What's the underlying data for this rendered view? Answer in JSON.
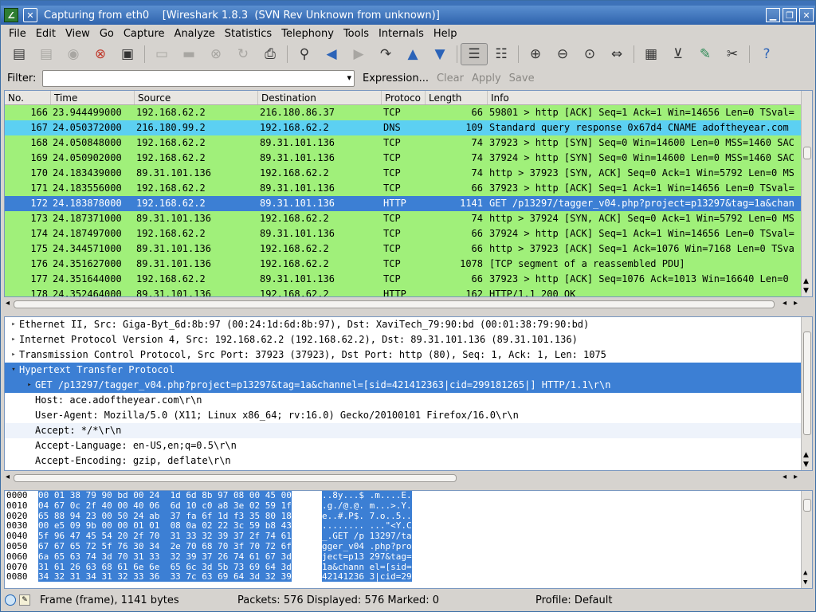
{
  "window": {
    "title": "Capturing from eth0    [Wireshark 1.8.3  (SVN Rev Unknown from unknown)]"
  },
  "menu": [
    "File",
    "Edit",
    "View",
    "Go",
    "Capture",
    "Analyze",
    "Statistics",
    "Telephony",
    "Tools",
    "Internals",
    "Help"
  ],
  "filter": {
    "label": "Filter:",
    "value": "",
    "expression": "Expression...",
    "clear": "Clear",
    "apply": "Apply",
    "save": "Save"
  },
  "packet_list": {
    "columns": [
      "No.",
      "Time",
      "Source",
      "Destination",
      "Protoco",
      "Length",
      "Info"
    ],
    "rows": [
      {
        "no": "166",
        "time": "23.944499000",
        "src": "192.168.62.2",
        "dst": "216.180.86.37",
        "proto": "TCP",
        "len": "66",
        "info": "59801 > http [ACK] Seq=1 Ack=1 Win=14656 Len=0 TSval=",
        "color": "#a0f07a"
      },
      {
        "no": "167",
        "time": "24.050372000",
        "src": "216.180.99.2",
        "dst": "192.168.62.2",
        "proto": "DNS",
        "len": "109",
        "info": "Standard query response 0x67d4  CNAME adoftheyear.com",
        "color": "#5cd0f2"
      },
      {
        "no": "168",
        "time": "24.050848000",
        "src": "192.168.62.2",
        "dst": "89.31.101.136",
        "proto": "TCP",
        "len": "74",
        "info": "37923 > http [SYN] Seq=0 Win=14600 Len=0 MSS=1460 SAC",
        "color": "#a0f07a"
      },
      {
        "no": "169",
        "time": "24.050902000",
        "src": "192.168.62.2",
        "dst": "89.31.101.136",
        "proto": "TCP",
        "len": "74",
        "info": "37924 > http [SYN] Seq=0 Win=14600 Len=0 MSS=1460 SAC",
        "color": "#a0f07a"
      },
      {
        "no": "170",
        "time": "24.183439000",
        "src": "89.31.101.136",
        "dst": "192.168.62.2",
        "proto": "TCP",
        "len": "74",
        "info": "http > 37923 [SYN, ACK] Seq=0 Ack=1 Win=5792 Len=0 MS",
        "color": "#a0f07a"
      },
      {
        "no": "171",
        "time": "24.183556000",
        "src": "192.168.62.2",
        "dst": "89.31.101.136",
        "proto": "TCP",
        "len": "66",
        "info": "37923 > http [ACK] Seq=1 Ack=1 Win=14656 Len=0 TSval=",
        "color": "#a0f07a"
      },
      {
        "no": "172",
        "time": "24.183878000",
        "src": "192.168.62.2",
        "dst": "89.31.101.136",
        "proto": "HTTP",
        "len": "1141",
        "info": "GET /p13297/tagger_v04.php?project=p13297&tag=1a&chan",
        "color": "#3c7fd4",
        "selected": true
      },
      {
        "no": "173",
        "time": "24.187371000",
        "src": "89.31.101.136",
        "dst": "192.168.62.2",
        "proto": "TCP",
        "len": "74",
        "info": "http > 37924 [SYN, ACK] Seq=0 Ack=1 Win=5792 Len=0 MS",
        "color": "#a0f07a"
      },
      {
        "no": "174",
        "time": "24.187497000",
        "src": "192.168.62.2",
        "dst": "89.31.101.136",
        "proto": "TCP",
        "len": "66",
        "info": "37924 > http [ACK] Seq=1 Ack=1 Win=14656 Len=0 TSval=",
        "color": "#a0f07a"
      },
      {
        "no": "175",
        "time": "24.344571000",
        "src": "89.31.101.136",
        "dst": "192.168.62.2",
        "proto": "TCP",
        "len": "66",
        "info": "http > 37923 [ACK] Seq=1 Ack=1076 Win=7168 Len=0 TSva",
        "color": "#a0f07a"
      },
      {
        "no": "176",
        "time": "24.351627000",
        "src": "89.31.101.136",
        "dst": "192.168.62.2",
        "proto": "TCP",
        "len": "1078",
        "info": "[TCP segment of a reassembled PDU]",
        "color": "#a0f07a"
      },
      {
        "no": "177",
        "time": "24.351644000",
        "src": "192.168.62.2",
        "dst": "89.31.101.136",
        "proto": "TCP",
        "len": "66",
        "info": "37923 > http [ACK] Seq=1076 Ack=1013 Win=16640 Len=0",
        "color": "#a0f07a"
      },
      {
        "no": "178",
        "time": "24.352464000",
        "src": "89.31.101.136",
        "dst": "192.168.62.2",
        "proto": "HTTP",
        "len": "162",
        "info": "HTTP/1.1 200 OK",
        "color": "#a0f07a"
      }
    ]
  },
  "details": [
    {
      "text": "Ethernet II, Src: Giga-Byt_6d:8b:97 (00:24:1d:6d:8b:97), Dst: XaviTech_79:90:bd (00:01:38:79:90:bd)",
      "indent": 0,
      "toggle": ">"
    },
    {
      "text": "Internet Protocol Version 4, Src: 192.168.62.2 (192.168.62.2), Dst: 89.31.101.136 (89.31.101.136)",
      "indent": 0,
      "toggle": ">"
    },
    {
      "text": "Transmission Control Protocol, Src Port: 37923 (37923), Dst Port: http (80), Seq: 1, Ack: 1, Len: 1075",
      "indent": 0,
      "toggle": ">"
    },
    {
      "text": "Hypertext Transfer Protocol",
      "indent": 0,
      "toggle": "v",
      "style": "section"
    },
    {
      "text": "GET /p13297/tagger_v04.php?project=p13297&tag=1a&channel=[sid=421412363|cid=299181265|] HTTP/1.1\\r\\n",
      "indent": 1,
      "toggle": ">",
      "style": "selected"
    },
    {
      "text": "Host: ace.adoftheyear.com\\r\\n",
      "indent": 1,
      "toggle": ""
    },
    {
      "text": "User-Agent: Mozilla/5.0 (X11; Linux x86_64; rv:16.0) Gecko/20100101 Firefox/16.0\\r\\n",
      "indent": 1,
      "toggle": ""
    },
    {
      "text": "Accept: */*\\r\\n",
      "indent": 1,
      "toggle": "",
      "style": "hover"
    },
    {
      "text": "Accept-Language: en-US,en;q=0.5\\r\\n",
      "indent": 1,
      "toggle": ""
    },
    {
      "text": "Accept-Encoding: gzip, deflate\\r\\n",
      "indent": 1,
      "toggle": ""
    }
  ],
  "bytes": [
    {
      "off": "0000",
      "hex1": "",
      "hexsel": "00 01 38 79 90 bd 00 24  1d 6d 8b 97 08 00 45 00",
      "ascsel": "..8y...$ .m....E."
    },
    {
      "off": "0010",
      "hex1": "",
      "hexsel": "04 67 0c 2f 40 00 40 06  6d 10 c0 a8 3e 02 59 1f",
      "ascsel": ".g./@.@. m...>.Y."
    },
    {
      "off": "0020",
      "hex1": "",
      "hexsel": "65 88 94 23 00 50 24 ab  37 fa 6f 1d f3 35 80 18",
      "ascsel": "e..#.P$. 7.o..5.."
    },
    {
      "off": "0030",
      "hex1": "",
      "hexsel": "00 e5 09 9b 00 00 01 01  08 0a 02 22 3c 59 b8 43",
      "ascsel": "........ ...\"<Y.C"
    },
    {
      "off": "0040",
      "hex1": "",
      "hexsel": "5f 96 47 45 54 20 2f 70  31 33 32 39 37 2f 74 61",
      "ascsel": "_.GET /p 13297/ta"
    },
    {
      "off": "0050",
      "hex1": "",
      "hexsel": "67 67 65 72 5f 76 30 34  2e 70 68 70 3f 70 72 6f",
      "ascsel": "gger_v04 .php?pro"
    },
    {
      "off": "0060",
      "hex1": "",
      "hexsel": "6a 65 63 74 3d 70 31 33  32 39 37 26 74 61 67 3d",
      "ascsel": "ject=p13 297&tag="
    },
    {
      "off": "0070",
      "hex1": "",
      "hexsel": "31 61 26 63 68 61 6e 6e  65 6c 3d 5b 73 69 64 3d",
      "ascsel": "1a&chann el=[sid="
    },
    {
      "off": "0080",
      "hex1": "",
      "hexsel": "34 32 31 34 31 32 33 36  33 7c 63 69 64 3d 32 39",
      "ascsel": "42141236 3|cid=29"
    }
  ],
  "status": {
    "frame": "Frame (frame), 1141 bytes",
    "packets": "Packets: 576 Displayed: 576 Marked: 0",
    "profile": "Profile: Default"
  },
  "colors": {
    "tcp": "#a0f07a",
    "dns": "#5cd0f2",
    "selected": "#3c7fd4"
  }
}
